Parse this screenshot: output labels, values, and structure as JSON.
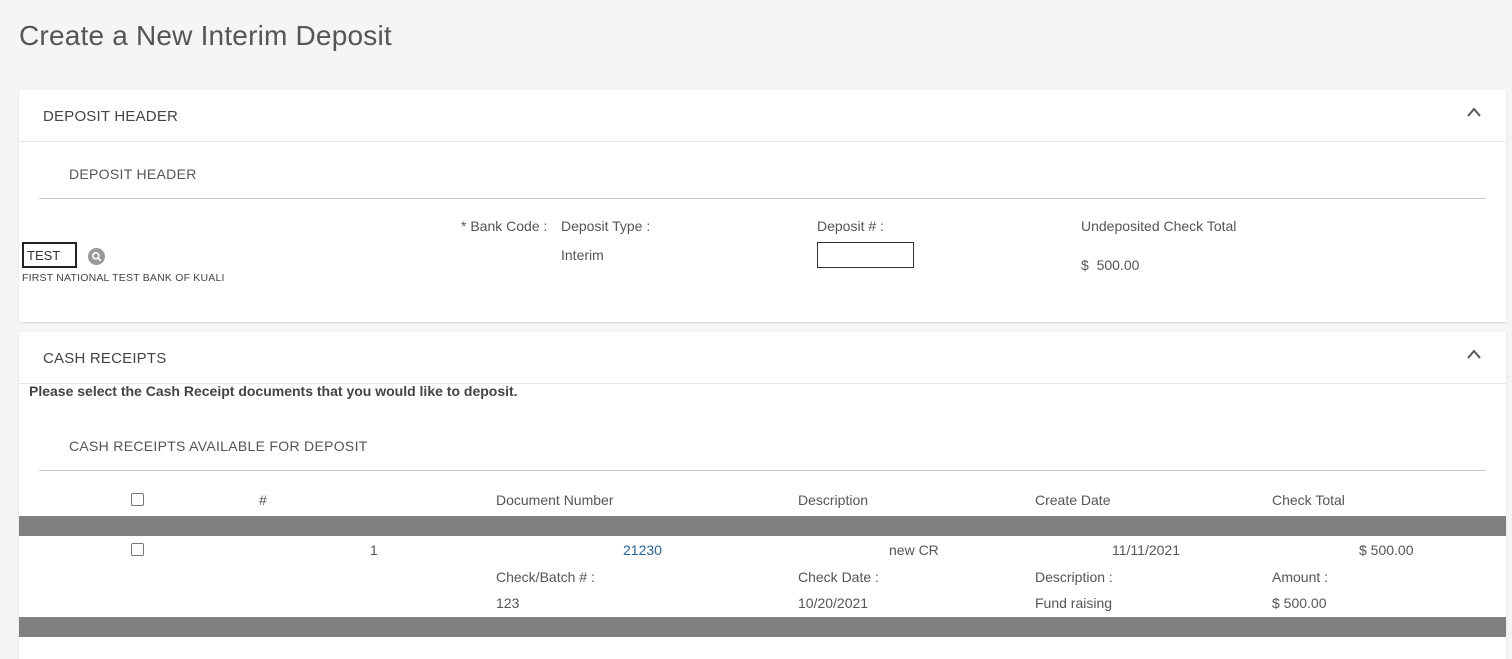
{
  "page": {
    "title": "Create a New Interim Deposit"
  },
  "deposit_header": {
    "panel_title": "DEPOSIT HEADER",
    "section_title": "DEPOSIT HEADER",
    "bank_code_label": "* Bank Code :",
    "bank_code_value": "TEST",
    "bank_name": "FIRST NATIONAL TEST BANK OF KUALI",
    "deposit_type_label": "Deposit Type :",
    "deposit_type_value": "Interim",
    "deposit_number_label": "Deposit # :",
    "deposit_number_value": "",
    "undeposited_label": "Undeposited Check Total",
    "undeposited_value": "$  500.00"
  },
  "cash_receipts": {
    "panel_title": "CASH RECEIPTS",
    "instructions": "Please select the Cash Receipt documents that you would like to deposit.",
    "section_title": "CASH RECEIPTS AVAILABLE FOR DEPOSIT",
    "columns": [
      "#",
      "Document Number",
      "Description",
      "Create Date",
      "Check Total"
    ],
    "rows": [
      {
        "index": "1",
        "document_number": "21230",
        "description": "new CR",
        "create_date": "11/11/2021",
        "check_total": "$ 500.00",
        "detail": {
          "check_batch_label": "Check/Batch # :",
          "check_batch_value": "123",
          "check_date_label": "Check Date :",
          "check_date_value": "10/20/2021",
          "description_label": "Description :",
          "description_value": "Fund raising",
          "amount_label": "Amount :",
          "amount_value": "$ 500.00"
        }
      }
    ]
  }
}
